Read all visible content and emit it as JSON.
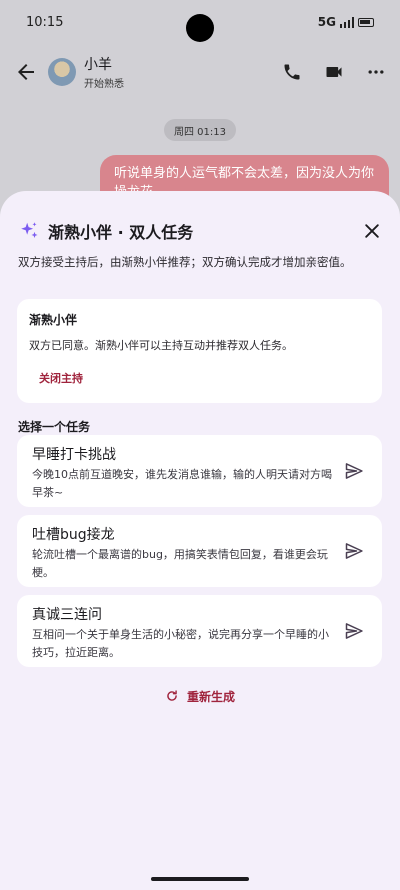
{
  "status_bar": {
    "time": "10:15",
    "network": "5G"
  },
  "chat": {
    "contact_name": "小羊",
    "contact_status": "开始熟悉",
    "date_chip": "周四 01:13",
    "bubble_text": "听说单身的人运气都不会太差，因为没人为你操龙花"
  },
  "sheet": {
    "title": "渐熟小伴 · 双人任务",
    "description": "双方接受主持后，由渐熟小伴推荐；双方确认完成才增加亲密值。",
    "host": {
      "title": "渐熟小伴",
      "description": "双方已同意。渐熟小伴可以主持互动并推荐双人任务。",
      "close_label": "关闭主持"
    },
    "section_label": "选择一个任务",
    "tasks": [
      {
        "title": "早睡打卡挑战",
        "description": "今晚10点前互道晚安，谁先发消息谁输，输的人明天请对方喝早茶~"
      },
      {
        "title": "吐槽bug接龙",
        "description": "轮流吐槽一个最离谱的bug，用搞笑表情包回复，看谁更会玩梗。"
      },
      {
        "title": "真诚三连问",
        "description": "互相问一个关于单身生活的小秘密，说完再分享一个早睡的小技巧，拉近距离。"
      }
    ],
    "regenerate_label": "重新生成"
  },
  "colors": {
    "accent": "#a0243d",
    "sheet_bg": "#f4effa",
    "sparkle": "#7b5cf0"
  },
  "icons": {
    "header": [
      "back-icon",
      "phone-icon",
      "video-icon",
      "more-icon"
    ],
    "sheet": [
      "sparkle-icon",
      "close-icon",
      "send-icon",
      "refresh-icon"
    ]
  }
}
